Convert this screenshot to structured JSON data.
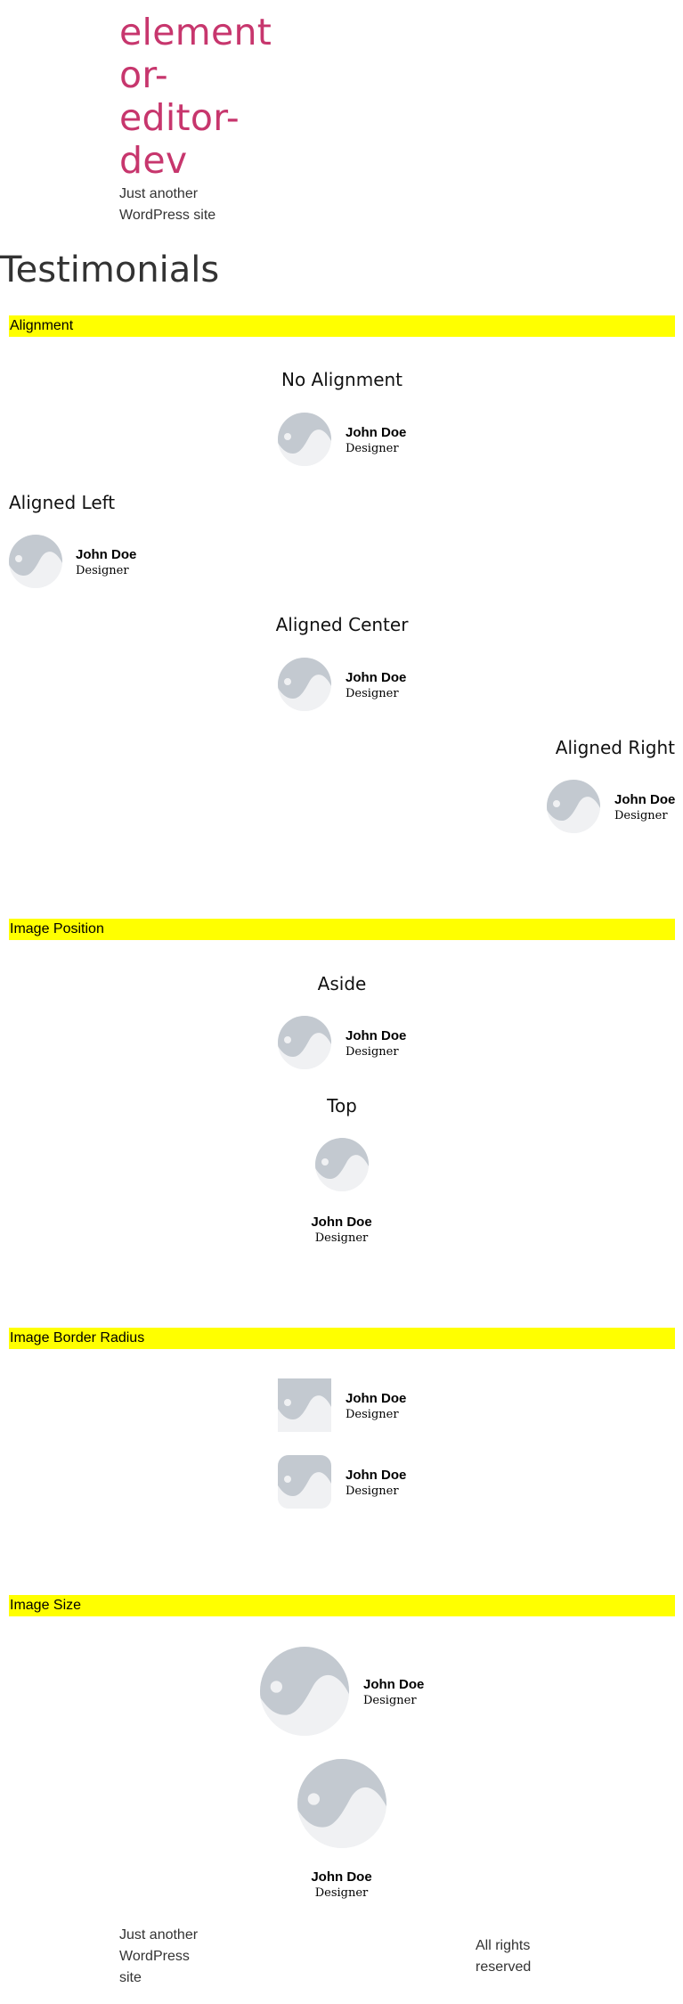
{
  "site": {
    "title": "element or- editor- dev",
    "tagline": "Just another WordPress site"
  },
  "page": {
    "title": "Testimonials"
  },
  "sections": {
    "alignment": {
      "label": "Alignment",
      "headings": {
        "none": "No Alignment",
        "left": "Aligned Left",
        "center": "Aligned Center",
        "right": "Aligned Right"
      }
    },
    "image_position": {
      "label": "Image Position",
      "headings": {
        "aside": "Aside",
        "top": "Top"
      }
    },
    "border_radius": {
      "label": "Image Border Radius"
    },
    "image_size": {
      "label": "Image Size"
    }
  },
  "testimonial": {
    "name": "John Doe",
    "job_title": "Designer"
  },
  "footer": {
    "tagline": "Just another WordPress site",
    "rights": "All rights reserved"
  },
  "colors": {
    "site_title": "#c7366d",
    "section_bar": "#ffff00",
    "placeholder_dark": "#c3c9d0",
    "placeholder_light": "#f0f1f3"
  },
  "icons": {
    "avatar": "image-placeholder-icon"
  }
}
